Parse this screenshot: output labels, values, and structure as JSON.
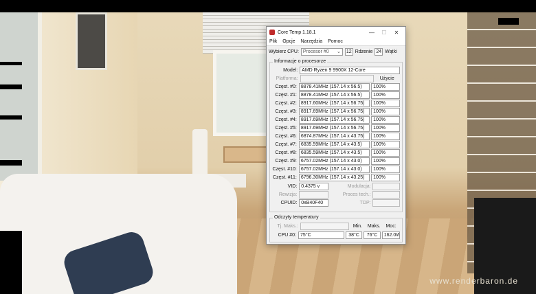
{
  "desktop": {
    "watermark": "www.renderbaron.de"
  },
  "window": {
    "title": "Core Temp 1.18.1",
    "controls": {
      "minimize": "—",
      "maximize": "☐",
      "close": "✕"
    },
    "menu": [
      "Plik",
      "Opcje",
      "Narzędzia",
      "Pomoc"
    ]
  },
  "toolbar": {
    "cpu_label": "Wybierz CPU:",
    "cpu_value": "Procesor #0",
    "cores_value": "12",
    "cores_label": "Rdzenie",
    "threads_value": "24",
    "threads_label": "Wątki"
  },
  "processor": {
    "legend": "Informacje o procesorze",
    "model_label": "Model:",
    "model_value": "AMD Ryzen 9 9900X 12-Core",
    "platform_label": "Platforma:",
    "usage_header": "Użycie",
    "cores": [
      {
        "label": "Częst. #0:",
        "freq": "8878.41MHz (157.14 x 56.5)",
        "usage": "100%"
      },
      {
        "label": "Częst. #1:",
        "freq": "8878.41MHz (157.14 x 56.5)",
        "usage": "100%"
      },
      {
        "label": "Częst. #2:",
        "freq": "8917.60MHz (157.14 x 56.75)",
        "usage": "100%"
      },
      {
        "label": "Częst. #3:",
        "freq": "8917.69MHz (157.14 x 56.75)",
        "usage": "100%"
      },
      {
        "label": "Częst. #4:",
        "freq": "8917.69MHz (157.14 x 56.75)",
        "usage": "100%"
      },
      {
        "label": "Częst. #5:",
        "freq": "8917.69MHz (157.14 x 56.75)",
        "usage": "100%"
      },
      {
        "label": "Częst. #6:",
        "freq": "6874.87MHz (157.14 x 43.75)",
        "usage": "100%"
      },
      {
        "label": "Częst. #7:",
        "freq": "6835.59MHz (157.14 x 43.5)",
        "usage": "100%"
      },
      {
        "label": "Częst. #8:",
        "freq": "6835.59MHz (157.14 x 43.5)",
        "usage": "100%"
      },
      {
        "label": "Częst. #9:",
        "freq": "6757.02MHz (157.14 x 43.0)",
        "usage": "100%"
      },
      {
        "label": "Częst. #10:",
        "freq": "6757.02MHz (157.14 x 43.0)",
        "usage": "100%"
      },
      {
        "label": "Częst. #11:",
        "freq": "6796.30MHz (157.14 x 43.25)",
        "usage": "100%"
      }
    ],
    "vid_label": "VID:",
    "vid_value": "0.4375 v",
    "modulation_label": "Modulacja:",
    "revision_label": "Rewizja:",
    "process_label": "Proces tech.:",
    "cpuid_label": "CPUID:",
    "cpuid_value": "0xB40F40",
    "tdp_label": "TDP:"
  },
  "temps": {
    "legend": "Odczyty temperatury",
    "tjmax_label": "Tj. Maks.:",
    "min_header": "Min.",
    "max_header": "Maks.",
    "power_header": "Moc:",
    "cpu_label": "CPU #0:",
    "cpu_temp": "75°C",
    "min_value": "38°C",
    "max_value": "76°C",
    "power_value": "162.0W"
  }
}
